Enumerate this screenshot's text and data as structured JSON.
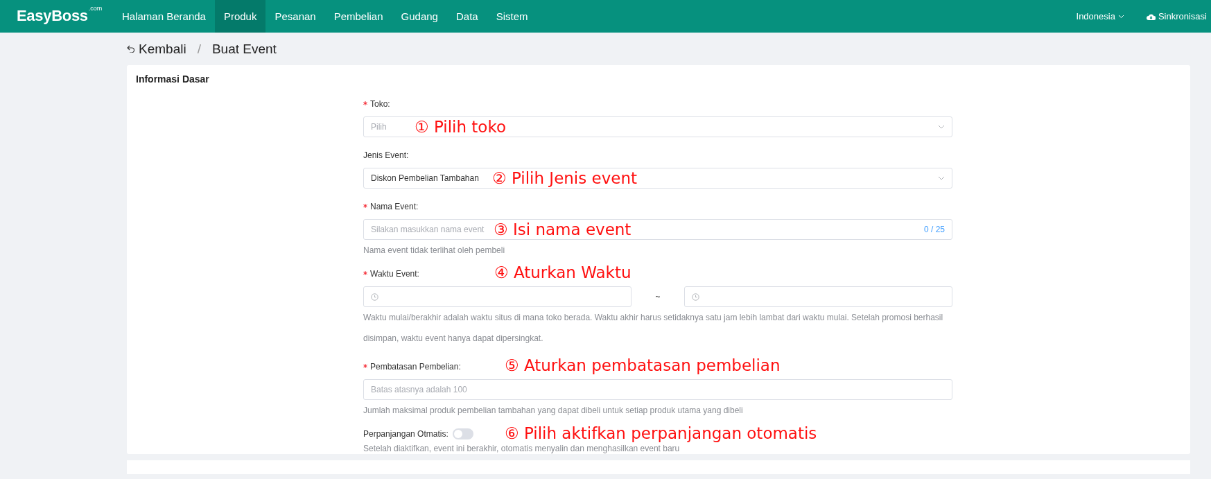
{
  "header": {
    "logo": "EasyBoss",
    "logo_suffix": ".com",
    "nav": [
      {
        "label": "Halaman Beranda",
        "selected": false
      },
      {
        "label": "Produk",
        "selected": true
      },
      {
        "label": "Pesanan",
        "selected": false
      },
      {
        "label": "Pembelian",
        "selected": false
      },
      {
        "label": "Gudang",
        "selected": false
      },
      {
        "label": "Data",
        "selected": false
      },
      {
        "label": "Sistem",
        "selected": false
      }
    ],
    "language": "Indonesia",
    "sync": "Sinkronisasi"
  },
  "breadcrumb": {
    "back": "Kembali",
    "separator": "/",
    "current": "Buat Event"
  },
  "section": {
    "title": "Informasi Dasar",
    "fields": [
      {
        "kind": "select",
        "label": "Toko:",
        "required": true,
        "placeholder": "Pilih",
        "annotation": "① Pilih toko"
      },
      {
        "kind": "select",
        "label": "Jenis Event:",
        "required": false,
        "value": "Diskon Pembelian Tambahan",
        "annotation": "② Pilih Jenis event"
      },
      {
        "kind": "input",
        "label": "Nama Event:",
        "required": true,
        "placeholder": "Silakan masukkan nama event",
        "counter": "0 / 25",
        "hint": "Nama event tidak terlihat oleh pembeli",
        "annotation": "③ Isi nama event"
      },
      {
        "kind": "daterange",
        "label": "Waktu Event:",
        "required": true,
        "separator": "~",
        "hint": "Waktu mulai/berakhir adalah waktu situs di mana toko berada. Waktu akhir harus setidaknya satu jam lebih lambat dari waktu mulai. Setelah promosi berhasil disimpan, waktu event hanya dapat dipersingkat.",
        "annotation": "④ Aturkan Waktu"
      },
      {
        "kind": "input",
        "label": "Pembatasan Pembelian:",
        "required": true,
        "placeholder": "Batas atasnya adalah 100",
        "hint": "Jumlah maksimal produk pembelian tambahan yang dapat dibeli untuk setiap produk utama yang dibeli",
        "annotation": "⑤ Aturkan pembatasan pembelian"
      },
      {
        "kind": "switch",
        "label": "Perpanjangan Otmatis:",
        "on": false,
        "hint": "Setelah diaktifkan, event ini berakhir, otomatis menyalin dan menghasilkan event baru",
        "annotation": "⑥ Pilih aktifkan perpanjangan otomatis"
      }
    ]
  }
}
